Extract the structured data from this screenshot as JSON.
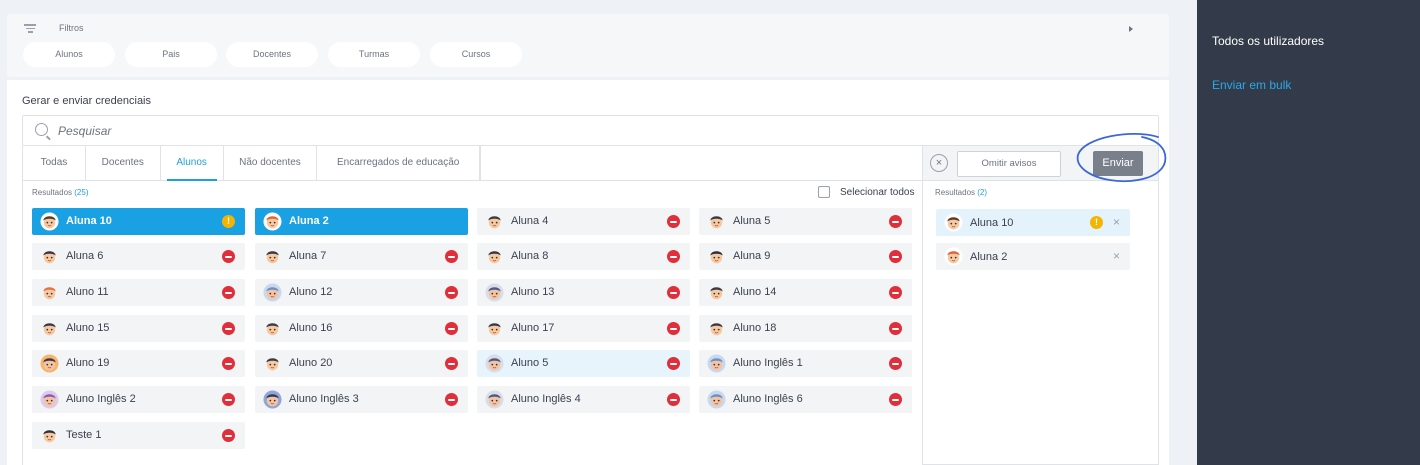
{
  "filters": {
    "label": "Filtros",
    "chips": [
      "Alunos",
      "Pais",
      "Docentes",
      "Turmas",
      "Cursos"
    ]
  },
  "section_title": "Gerar e enviar credenciais",
  "search": {
    "placeholder": "Pesquisar"
  },
  "tabs": [
    {
      "label": "Todas",
      "active": false
    },
    {
      "label": "Docentes",
      "active": false
    },
    {
      "label": "Alunos",
      "active": true
    },
    {
      "label": "Não docentes",
      "active": false
    },
    {
      "label": "Encarregados de educação",
      "active": false
    }
  ],
  "results": {
    "label": "Resultados",
    "count": "(25)"
  },
  "select_all": "Selecionar todos",
  "students": [
    {
      "name": "Aluna 10",
      "avatar": "girl-pigtails",
      "status": "warning",
      "state": "selected"
    },
    {
      "name": "Aluna 2",
      "avatar": "girl-red-hair",
      "status": "none",
      "state": "selected"
    },
    {
      "name": "Aluna 4",
      "avatar": "boy-dark-hair",
      "status": "blocked",
      "state": "normal"
    },
    {
      "name": "Aluna 5",
      "avatar": "boy-dark-hair",
      "status": "blocked",
      "state": "normal"
    },
    {
      "name": "Aluna 6",
      "avatar": "boy-dark-hair",
      "status": "blocked",
      "state": "normal"
    },
    {
      "name": "Aluna 7",
      "avatar": "boy-dark-hair",
      "status": "blocked",
      "state": "normal"
    },
    {
      "name": "Aluna 8",
      "avatar": "boy-dark-hair",
      "status": "blocked",
      "state": "normal"
    },
    {
      "name": "Aluna 9",
      "avatar": "girl-dark-hair",
      "status": "blocked",
      "state": "normal"
    },
    {
      "name": "Aluno 11",
      "avatar": "boy-orange-hair",
      "status": "blocked",
      "state": "normal"
    },
    {
      "name": "Aluno 12",
      "avatar": "man-blue",
      "status": "blocked",
      "state": "normal"
    },
    {
      "name": "Aluno 13",
      "avatar": "man-suit",
      "status": "blocked",
      "state": "normal"
    },
    {
      "name": "Aluno 14",
      "avatar": "boy-dark-hair",
      "status": "blocked",
      "state": "normal"
    },
    {
      "name": "Aluno 15",
      "avatar": "boy-dark-hair",
      "status": "blocked",
      "state": "normal"
    },
    {
      "name": "Aluno 16",
      "avatar": "boy-dark-hair",
      "status": "blocked",
      "state": "normal"
    },
    {
      "name": "Aluno 17",
      "avatar": "boy-dark-hair",
      "status": "blocked",
      "state": "normal"
    },
    {
      "name": "Aluno 18",
      "avatar": "boy-dark-hair",
      "status": "blocked",
      "state": "normal"
    },
    {
      "name": "Aluno 19",
      "avatar": "man-orange",
      "status": "blocked",
      "state": "normal"
    },
    {
      "name": "Aluno 20",
      "avatar": "boy-dark-hair",
      "status": "blocked",
      "state": "normal"
    },
    {
      "name": "Aluno 5",
      "avatar": "man-suit",
      "status": "blocked",
      "state": "hover"
    },
    {
      "name": "Aluno Inglês 1",
      "avatar": "man-blue",
      "status": "blocked",
      "state": "normal"
    },
    {
      "name": "Aluno Inglês 2",
      "avatar": "woman-purple",
      "status": "blocked",
      "state": "normal"
    },
    {
      "name": "Aluno Inglês 3",
      "avatar": "woman-dark-hair",
      "status": "blocked",
      "state": "normal"
    },
    {
      "name": "Aluno Inglês 4",
      "avatar": "man-suit",
      "status": "blocked",
      "state": "normal"
    },
    {
      "name": "Aluno Inglês 6",
      "avatar": "man-blue",
      "status": "blocked",
      "state": "normal"
    },
    {
      "name": "Teste 1",
      "avatar": "girl-dark-hair",
      "status": "blocked",
      "state": "normal"
    }
  ],
  "right_pane": {
    "clear_icon": "×",
    "omit_label": "Omitir avisos",
    "send_label": "Enviar",
    "results_label": "Resultados",
    "results_count": "(2)",
    "selected": [
      {
        "name": "Aluna 10",
        "avatar": "girl-pigtails",
        "warning": true
      },
      {
        "name": "Aluna 2",
        "avatar": "girl-red-hair",
        "warning": false
      }
    ],
    "remove_icon": "×"
  },
  "side_panel": {
    "all_users": "Todos os utilizadores",
    "bulk_send": "Enviar em bulk"
  },
  "colors": {
    "accent": "#1f9fe0",
    "selected_card": "#19a1e3",
    "blocked": "#e02e3a",
    "warning": "#f4b400",
    "side_panel": "#333b4a"
  }
}
